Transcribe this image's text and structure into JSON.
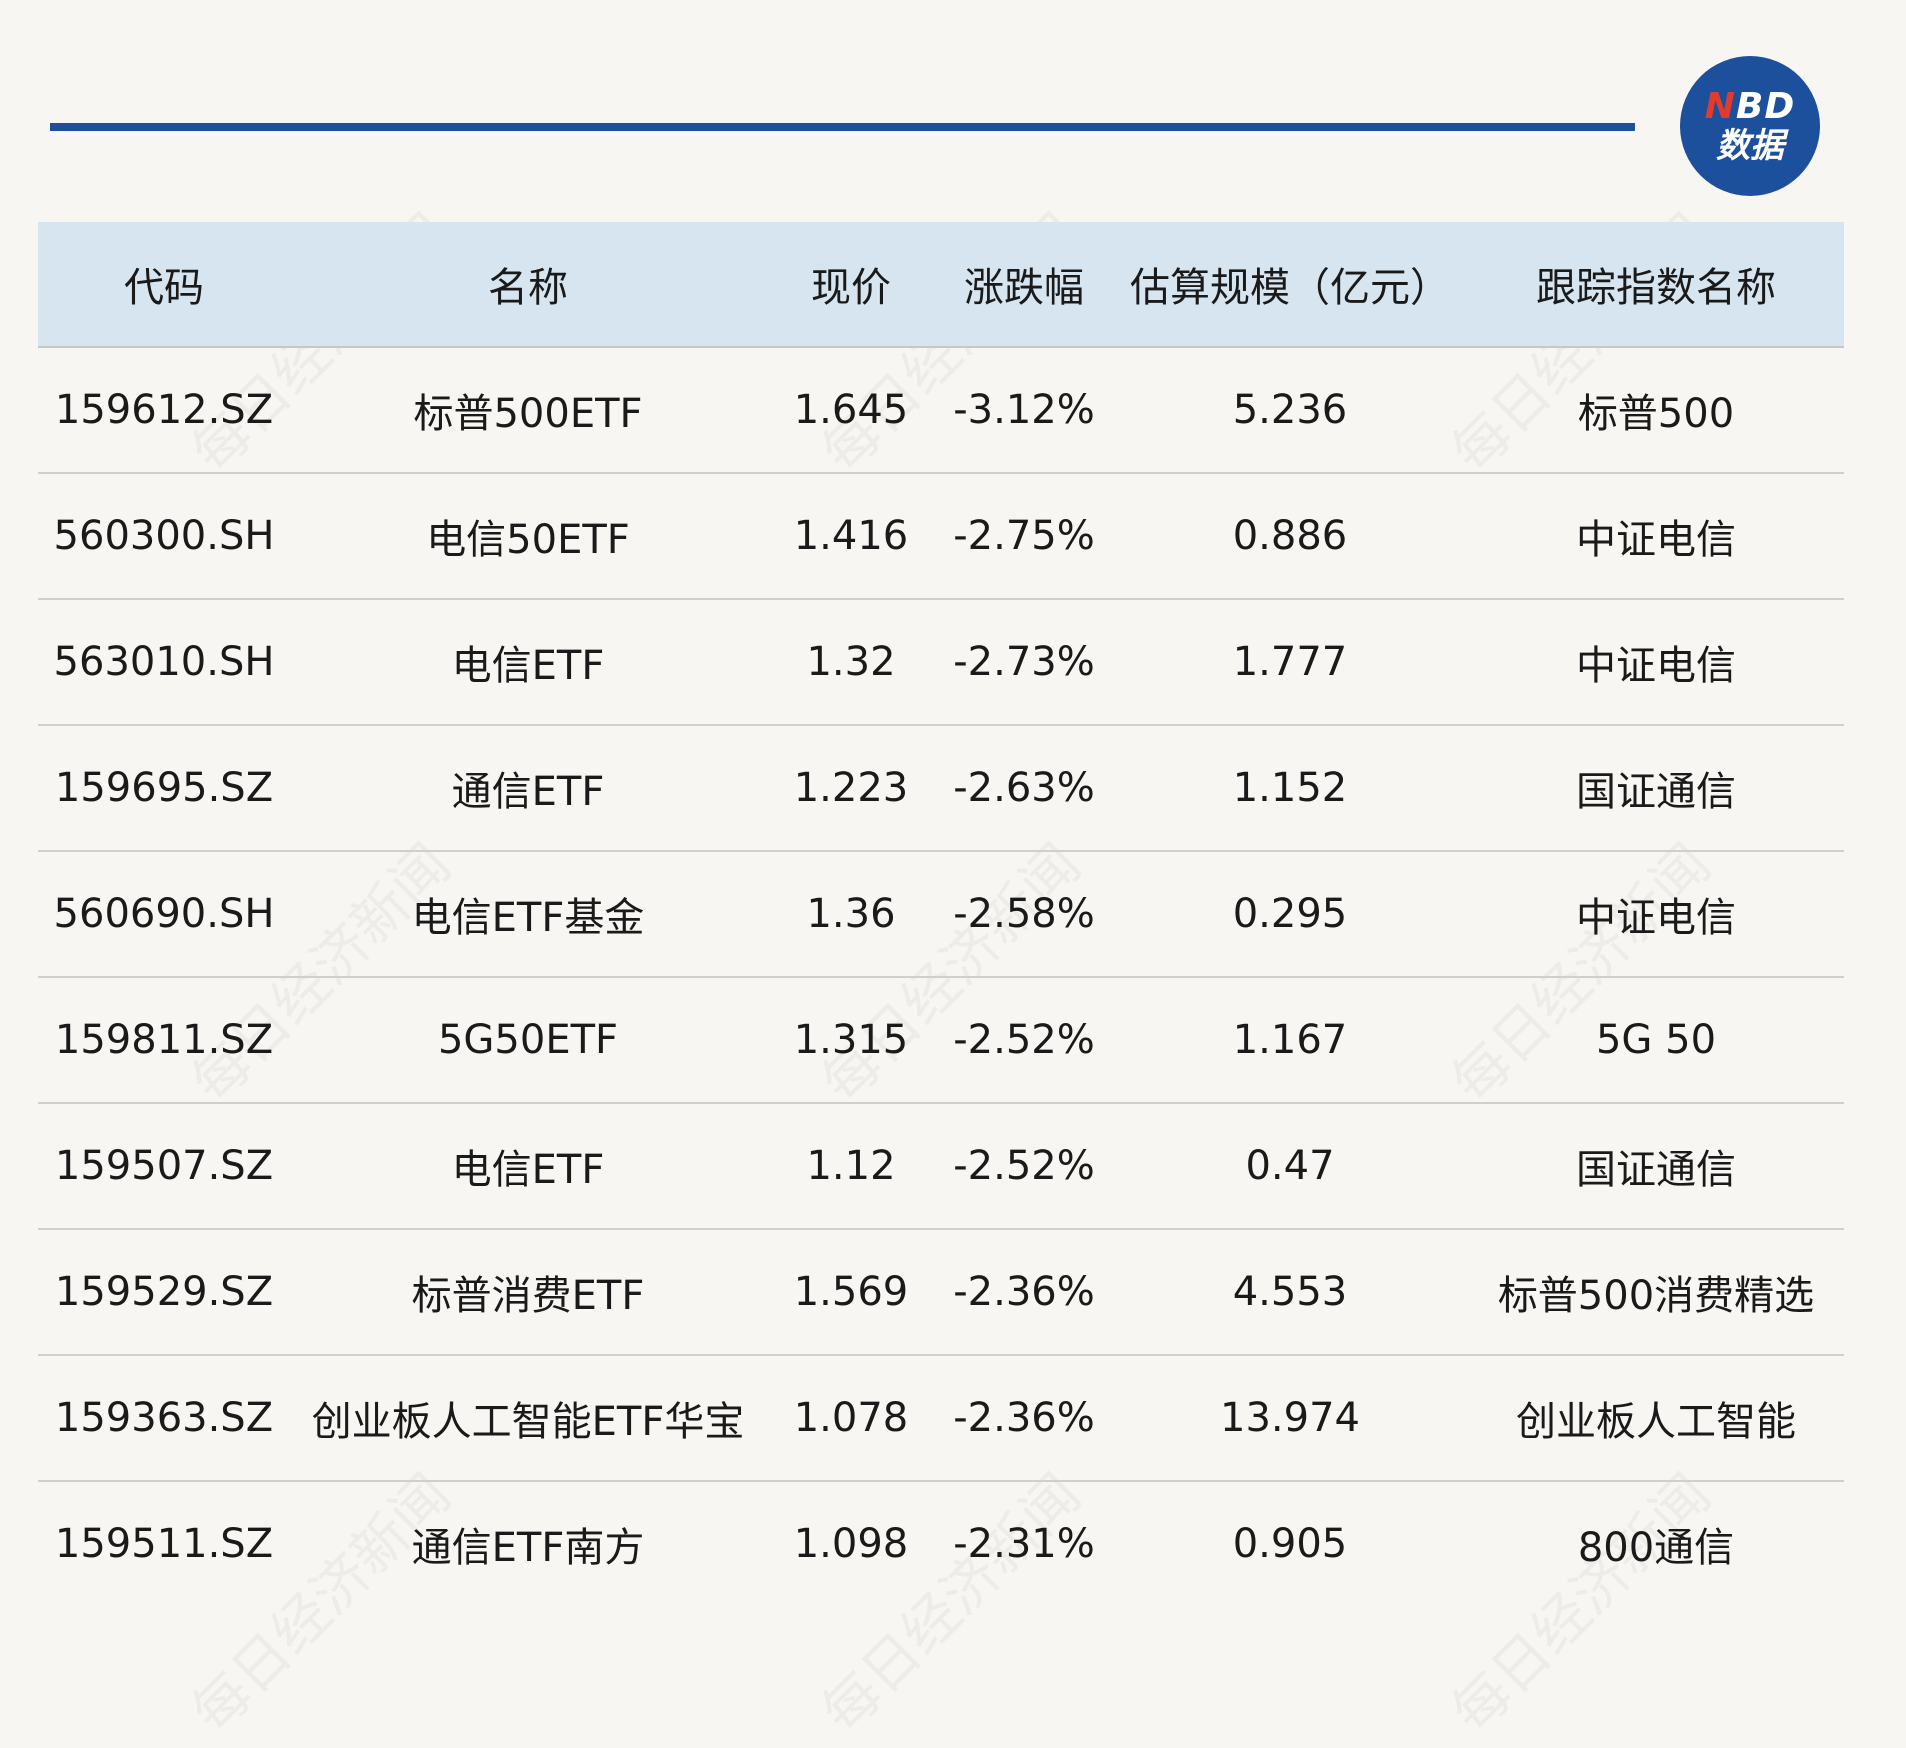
{
  "logo": {
    "line1_n": "N",
    "line1_rest": "BD",
    "line2": "数据"
  },
  "watermark_text": "每日经济新闻",
  "table": {
    "headers": [
      "代码",
      "名称",
      "现价",
      "涨跌幅",
      "估算规模（亿元）",
      "跟踪指数名称"
    ],
    "rows": [
      [
        "159612.SZ",
        "标普500ETF",
        "1.645",
        "-3.12%",
        "5.236",
        "标普500"
      ],
      [
        "560300.SH",
        "电信50ETF",
        "1.416",
        "-2.75%",
        "0.886",
        "中证电信"
      ],
      [
        "563010.SH",
        "电信ETF",
        "1.32",
        "-2.73%",
        "1.777",
        "中证电信"
      ],
      [
        "159695.SZ",
        "通信ETF",
        "1.223",
        "-2.63%",
        "1.152",
        "国证通信"
      ],
      [
        "560690.SH",
        "电信ETF基金",
        "1.36",
        "-2.58%",
        "0.295",
        "中证电信"
      ],
      [
        "159811.SZ",
        "5G50ETF",
        "1.315",
        "-2.52%",
        "1.167",
        "5G 50"
      ],
      [
        "159507.SZ",
        "电信ETF",
        "1.12",
        "-2.52%",
        "0.47",
        "国证通信"
      ],
      [
        "159529.SZ",
        "标普消费ETF",
        "1.569",
        "-2.36%",
        "4.553",
        "标普500消费精选"
      ],
      [
        "159363.SZ",
        "创业板人工智能ETF华宝",
        "1.078",
        "-2.36%",
        "13.974",
        "创业板人工智能"
      ],
      [
        "159511.SZ",
        "通信ETF南方",
        "1.098",
        "-2.31%",
        "0.905",
        "800通信"
      ]
    ]
  },
  "colors": {
    "background": "#f8f6f2",
    "header_bg": "#d7e5f1",
    "rule": "#1f4f9a",
    "logo_bg": "#1c4f9c",
    "logo_accent": "#e23b2e"
  }
}
